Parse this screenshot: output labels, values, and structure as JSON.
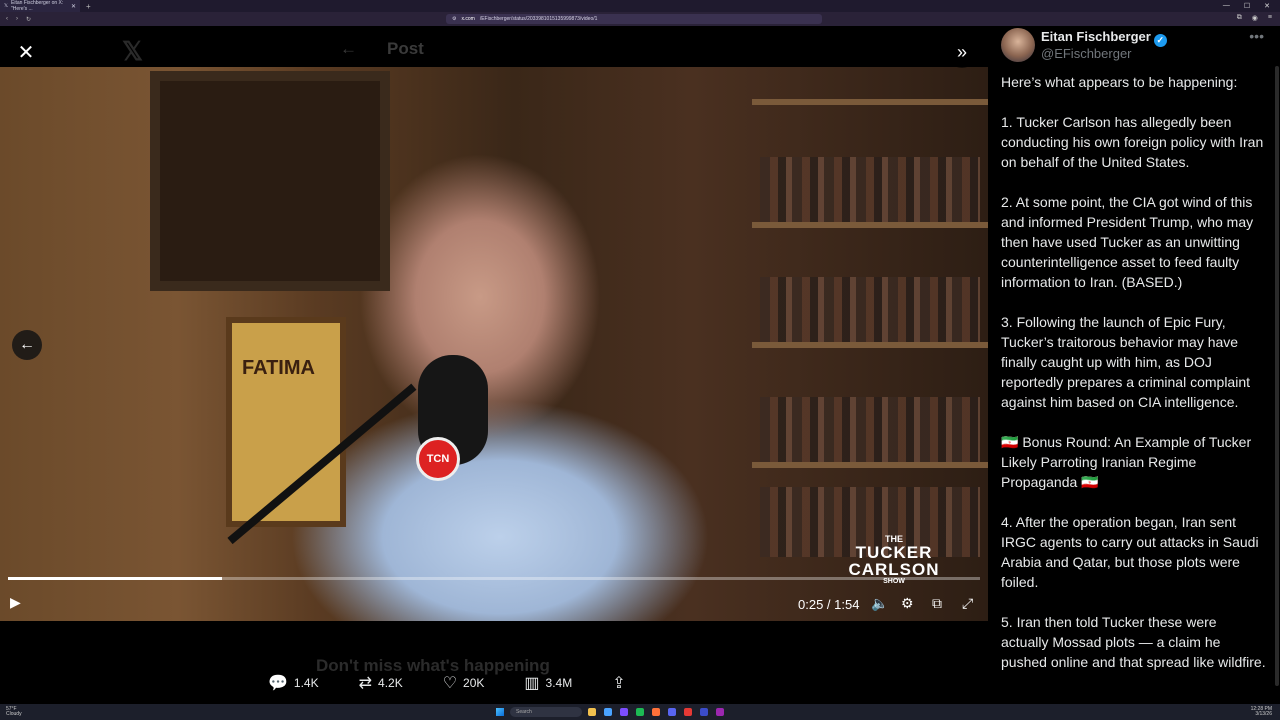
{
  "browser": {
    "tab_title": "Eitan Fischberger on X: \"Here's ...",
    "url_host": "x.com",
    "url_path": "/EFischberger/status/2033981015135999873/video/1"
  },
  "background": {
    "header_title": "Post",
    "caption": "Don't miss what's happening"
  },
  "media": {
    "sign_text": "FATIMA",
    "mic_badge": "TCN",
    "show_logo": {
      "the": "THE",
      "line1": "TUCKER",
      "line2": "CARLSON",
      "show": "SHOW"
    },
    "time": "0:25 / 1:54",
    "progress_fraction": 0.22
  },
  "actions": {
    "replies": "1.4K",
    "reposts": "4.2K",
    "likes": "20K",
    "views": "3.4M"
  },
  "author": {
    "name": "Eitan Fischberger",
    "handle": "@EFischberger"
  },
  "post": {
    "p1": "Here’s what appears to be happening:",
    "p2": "1. Tucker Carlson has allegedly been conducting his own foreign policy with Iran on behalf of the United States.",
    "p3": "2. At some point, the CIA got wind of this and informed President Trump, who may then have used Tucker as an unwitting counterintelligence asset to feed faulty information to Iran. (BASED.)",
    "p4": "3. Following the launch of Epic Fury, Tucker’s traitorous behavior may have finally caught up with him, as DOJ reportedly prepares a criminal complaint against him based on CIA intelligence.",
    "p5": "🇮🇷 Bonus Round: An Example of Tucker Likely Parroting Iranian Regime Propaganda 🇮🇷",
    "p6": "4. After the operation began, Iran sent IRGC agents to carry out attacks in Saudi Arabia and Qatar, but those plots were foiled.",
    "p7": "5. Iran then told Tucker these were actually Mossad plots — a claim he pushed online and that spread like wildfire."
  },
  "taskbar": {
    "weather_temp": "57°F",
    "weather_desc": "Cloudy",
    "search": "Search",
    "clock_time": "12:28 PM",
    "clock_date": "3/13/26"
  }
}
